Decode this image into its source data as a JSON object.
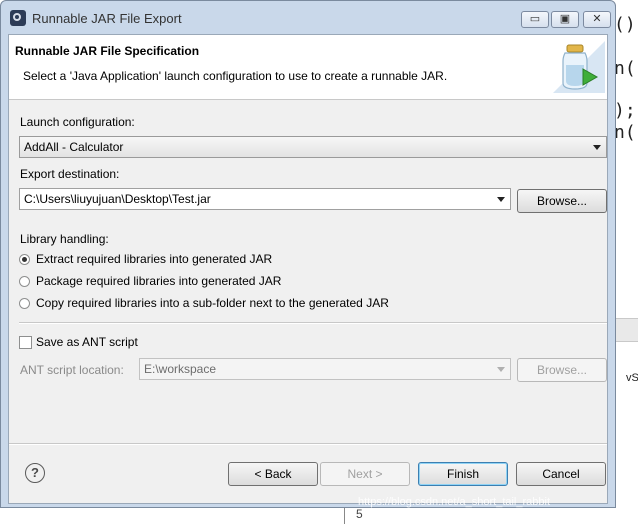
{
  "window": {
    "title": "Runnable JAR File Export",
    "controls": {
      "minimize": "▭",
      "maximize": "▣",
      "close": "✕"
    }
  },
  "header": {
    "title": "Runnable JAR File Specification",
    "description": "Select a 'Java Application' launch configuration to use to create a runnable JAR.",
    "icon": "jar-export-icon"
  },
  "launch": {
    "label": "Launch configuration:",
    "value": "AddAll - Calculator"
  },
  "export": {
    "label": "Export destination:",
    "value": "C:\\Users\\liuyujuan\\Desktop\\Test.jar",
    "browse_label": "Browse..."
  },
  "library": {
    "label": "Library handling:",
    "options": [
      {
        "label": "Extract required libraries into generated JAR",
        "checked": true
      },
      {
        "label": "Package required libraries into generated JAR",
        "checked": false
      },
      {
        "label": "Copy required libraries into a sub-folder next to the generated JAR",
        "checked": false
      }
    ]
  },
  "ant": {
    "checkbox_label": "Save as ANT script",
    "checked": false,
    "location_label": "ANT script location:",
    "location_value": "E:\\workspace",
    "browse_label": "Browse..."
  },
  "footer": {
    "help": "?",
    "back_label": "< Back",
    "next_label": "Next >",
    "finish_label": "Finish",
    "cancel_label": "Cancel"
  },
  "background": {
    "code_lines": [
      "()",
      "n(",
      ");",
      "n("
    ],
    "side_text": "vSc",
    "bottom_text": "5"
  },
  "watermark": "https://blog.csdn.net/a_short_tail_rabbit",
  "colors": {
    "title_bar": "#c9d8ea",
    "dialog_bg": "#f0f0f0",
    "default_button_border": "#3c7fb1"
  }
}
